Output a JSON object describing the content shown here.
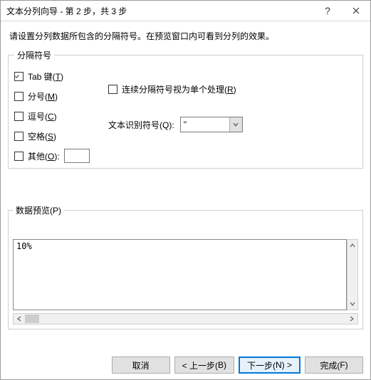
{
  "window": {
    "title": "文本分列向导 - 第 2 步，共 3 步"
  },
  "description": "请设置分列数据所包含的分隔符号。在预览窗口内可看到分列的效果。",
  "delimiters": {
    "legend": "分隔符号",
    "tab_label_pre": "Tab 键(",
    "tab_u": "T",
    "tab_label_post": ")",
    "semicolon_pre": "分号(",
    "semicolon_u": "M",
    "semicolon_post": ")",
    "comma_pre": "逗号(",
    "comma_u": "C",
    "comma_post": ")",
    "space_pre": "空格(",
    "space_u": "S",
    "space_post": ")",
    "other_pre": "其他(",
    "other_u": "O",
    "other_post": ":",
    "consecutive_pre": "连续分隔符号视为单个处理(",
    "consecutive_u": "R",
    "consecutive_post": ")",
    "qualifier_label_pre": "文本识别符号(",
    "qualifier_u": "Q",
    "qualifier_label_post": ":",
    "qualifier_value": "\""
  },
  "preview": {
    "legend_pre": "数据预览(",
    "legend_u": "P",
    "legend_post": ")",
    "content": "10%"
  },
  "buttons": {
    "cancel": "取消",
    "back_pre": "< 上一步(",
    "back_u": "B",
    "back_post": ")",
    "next_pre": "下一步(",
    "next_u": "N",
    "next_post": ") >",
    "finish_pre": "完成(",
    "finish_u": "F",
    "finish_post": ")"
  }
}
